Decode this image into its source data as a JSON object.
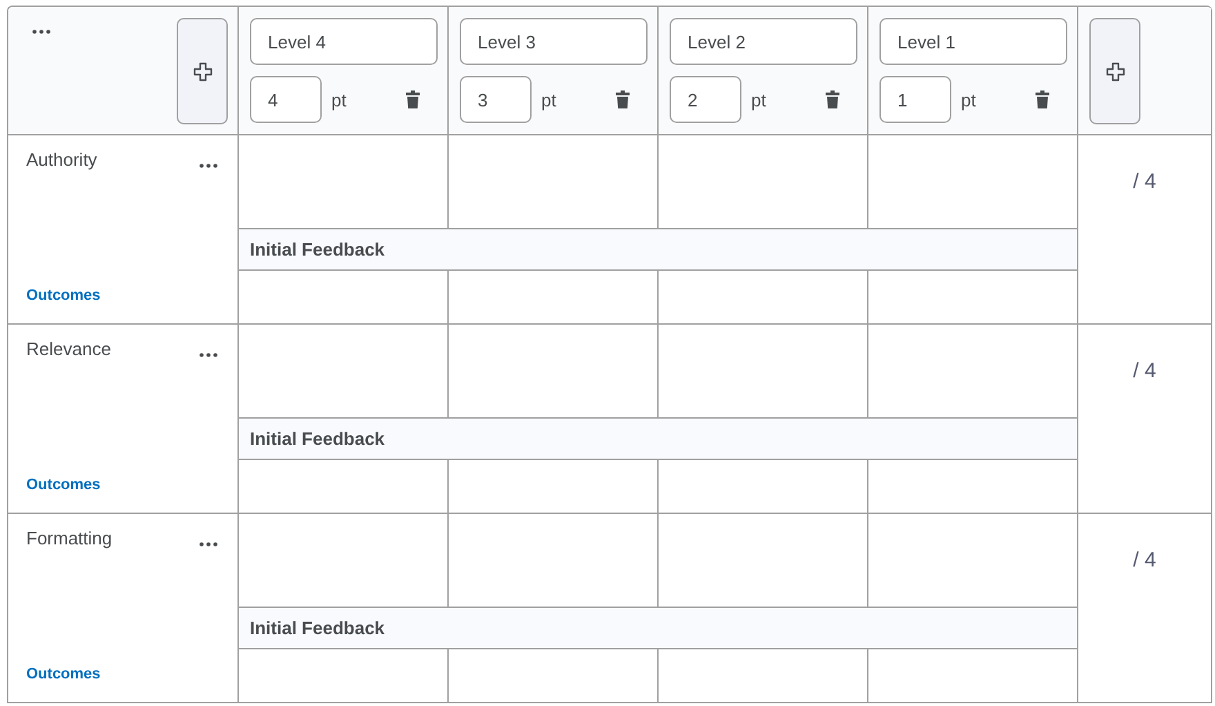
{
  "levels": [
    {
      "name": "Level 4",
      "points": "4",
      "unit": "pt"
    },
    {
      "name": "Level 3",
      "points": "3",
      "unit": "pt"
    },
    {
      "name": "Level 2",
      "points": "2",
      "unit": "pt"
    },
    {
      "name": "Level 1",
      "points": "1",
      "unit": "pt"
    }
  ],
  "criteria": [
    {
      "name": "Authority",
      "link": "Outcomes",
      "feedback": "Initial Feedback",
      "score": "/ 4"
    },
    {
      "name": "Relevance",
      "link": "Outcomes",
      "feedback": "Initial Feedback",
      "score": "/ 4"
    },
    {
      "name": "Formatting",
      "link": "Outcomes",
      "feedback": "Initial Feedback",
      "score": "/ 4"
    }
  ]
}
